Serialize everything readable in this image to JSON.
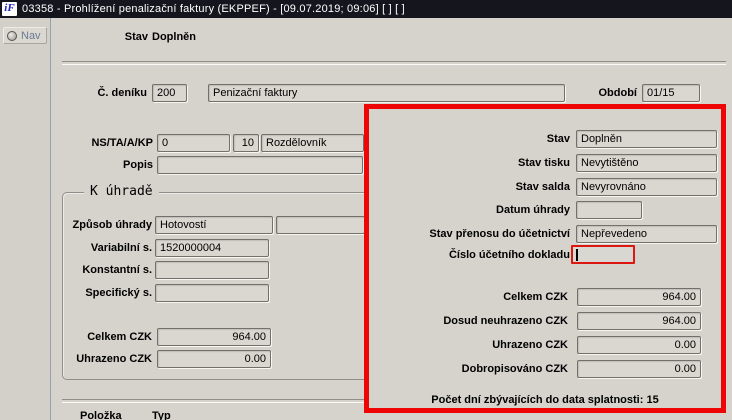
{
  "window": {
    "icon_text": "iF",
    "title": "03358 - Prohlížení penalizační faktury (EKPPEF) - [09.07.2019; 09:06]  [ ]  [ ]"
  },
  "sidebar": {
    "nav_label": "Nav"
  },
  "header": {
    "stav_label": "Stav",
    "stav_value": "Doplněn"
  },
  "invoice": {
    "denik_label": "Č. deníku",
    "denik_number": "200",
    "denik_name": "Penizační faktury",
    "obdobi_label": "Období",
    "obdobi_value": "01/15",
    "ns_label": "NS/TA/A/KP",
    "ns_value1": "0",
    "ns_value2": "10",
    "ns_value3": "Rozdělovník",
    "popis_label": "Popis",
    "popis_value": ""
  },
  "k_uhrade": {
    "legend": "K úhradě",
    "zpusob_label": "Způsob úhrady",
    "zpusob_value": "Hotovostí",
    "zpusob_value2": "",
    "variabilni_label": "Variabilní s.",
    "variabilni_value": "1520000004",
    "konstantni_label": "Konstantní s.",
    "konstantni_value": "",
    "specificky_label": "Specifický s.",
    "specificky_value": "",
    "celkem_label": "Celkem CZK",
    "celkem_value": "964.00",
    "uhrazeno_label": "Uhrazeno CZK",
    "uhrazeno_value": "0.00"
  },
  "status_panel": {
    "stav_label": "Stav",
    "stav_value": "Doplněn",
    "tisk_label": "Stav tisku",
    "tisk_value": "Nevytištěno",
    "saldo_label": "Stav salda",
    "saldo_value": "Nevyrovnáno",
    "datum_label": "Datum úhrady",
    "datum_value": "",
    "prenos_label": "Stav přenosu do účetnictví",
    "prenos_value": "Nepřevedeno",
    "doklad_label": "Číslo účetního dokladu",
    "doklad_value": "",
    "celkem_label": "Celkem CZK",
    "celkem_value": "964.00",
    "neuhrazeno_label": "Dosud neuhrazeno CZK",
    "neuhrazeno_value": "964.00",
    "uhrazeno_label": "Uhrazeno CZK",
    "uhrazeno_value": "0.00",
    "dobropisovano_label": "Dobropisováno CZK",
    "dobropisovano_value": "0.00",
    "days_note": "Počet dní zbývajících do data splatnosti: 15"
  },
  "footer": {
    "polozka_label": "Položka",
    "typ_label": "Typ"
  },
  "colors": {
    "highlight_red": "#ee0606",
    "titlebar": "#15151e",
    "focus_border": "#dd1612"
  }
}
